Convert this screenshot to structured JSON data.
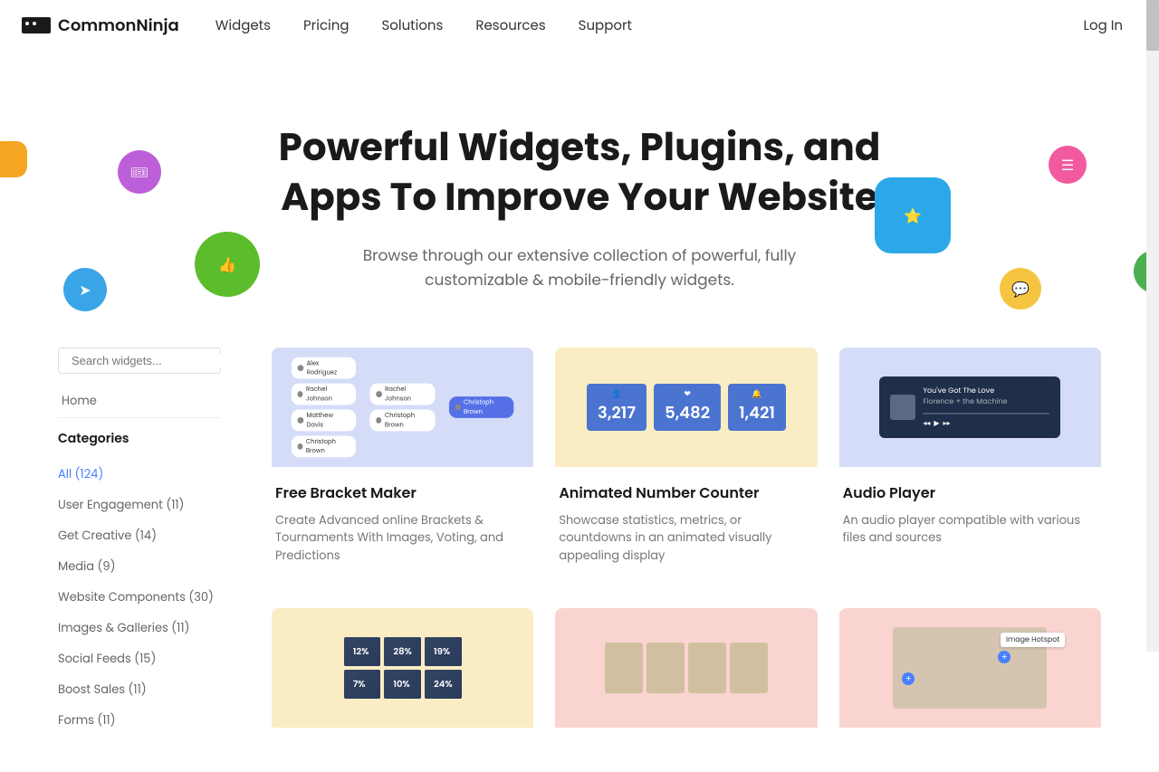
{
  "brand": "CommonNinja",
  "nav": [
    "Widgets",
    "Pricing",
    "Solutions",
    "Resources",
    "Support"
  ],
  "login": "Log In",
  "hero": {
    "title": "Powerful Widgets, Plugins, and Apps To Improve Your Website",
    "subtitle": "Browse through our extensive collection of powerful, fully customizable & mobile-friendly widgets."
  },
  "search": {
    "placeholder": "Search widgets..."
  },
  "sidebar": {
    "home": "Home",
    "categories_label": "Categories",
    "categories": [
      {
        "label": "All (124)",
        "active": true
      },
      {
        "label": "User Engagement (11)"
      },
      {
        "label": "Get Creative (14)"
      },
      {
        "label": "Media (9)"
      },
      {
        "label": "Website Components (30)"
      },
      {
        "label": "Images & Galleries (11)"
      },
      {
        "label": "Social Feeds (15)"
      },
      {
        "label": "Boost Sales (11)"
      },
      {
        "label": "Forms (11)"
      }
    ]
  },
  "cards": [
    {
      "title": "Free Bracket Maker",
      "desc": "Create Advanced online Brackets & Tournaments With Images, Voting, and Predictions"
    },
    {
      "title": "Animated Number Counter",
      "desc": "Showcase statistics, metrics, or countdowns in an animated visually appealing display"
    },
    {
      "title": "Audio Player",
      "desc": "An audio player compatible with various files and sources"
    }
  ],
  "bracket_names": [
    "Alex Rodriguez",
    "Rachel Johnson",
    "Matthew Davis",
    "Christoph Brown",
    "Rachel Johnson",
    "Christoph Brown",
    "Christoph Brown"
  ],
  "counters": [
    {
      "icon": "👤",
      "num": "3,217"
    },
    {
      "icon": "❤",
      "num": "5,482"
    },
    {
      "icon": "🔔",
      "num": "1,421"
    }
  ],
  "player": {
    "track": "You've Got The Love",
    "artist": "Florence + the Machine"
  },
  "chart_pcts": [
    "12%",
    "28%",
    "19%",
    "7%",
    "10%",
    "24%"
  ],
  "hotspot_label": "Image Hotspot"
}
